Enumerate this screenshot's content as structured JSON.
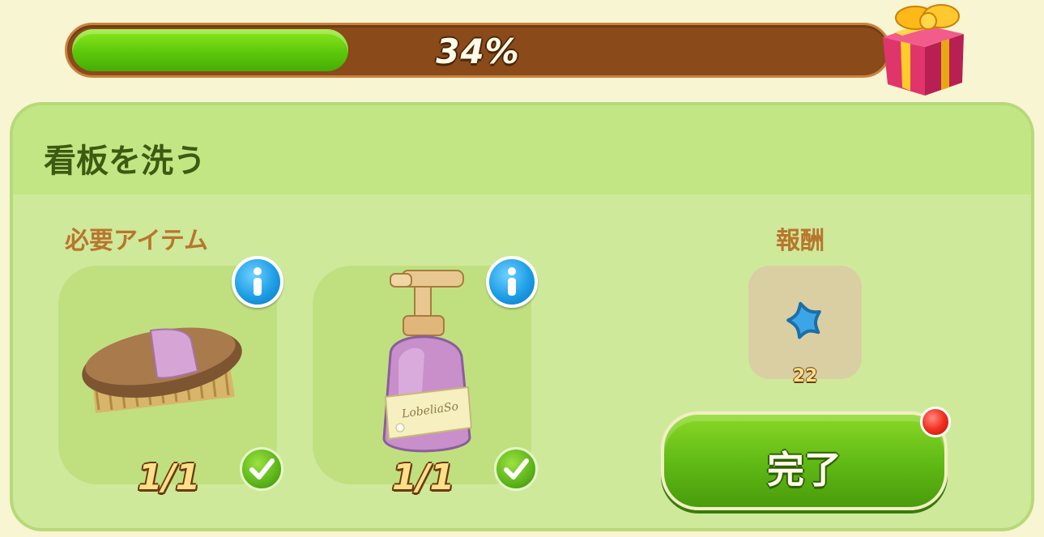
{
  "progress": {
    "percent": 34,
    "label": "34%"
  },
  "quest": {
    "title": "看板を洗う"
  },
  "required_items": {
    "heading": "必要アイテム",
    "items": [
      {
        "icon": "scrub-brush-icon",
        "count": "1/1",
        "complete": true
      },
      {
        "icon": "soap-bottle-icon",
        "count": "1/1",
        "complete": true,
        "bottle_label": "LobeliaSo"
      }
    ]
  },
  "reward": {
    "heading": "報酬",
    "icon": "blue-star-icon",
    "amount": "22"
  },
  "complete_button": {
    "label": "完了"
  },
  "colors": {
    "progress_fill": "#5cc80a",
    "progress_track": "#8a4a1a",
    "panel": "#cfe99b",
    "header": "#c3e684",
    "accent_text": "#b8762c",
    "button": "#5eb814",
    "notification": "#f23020"
  }
}
